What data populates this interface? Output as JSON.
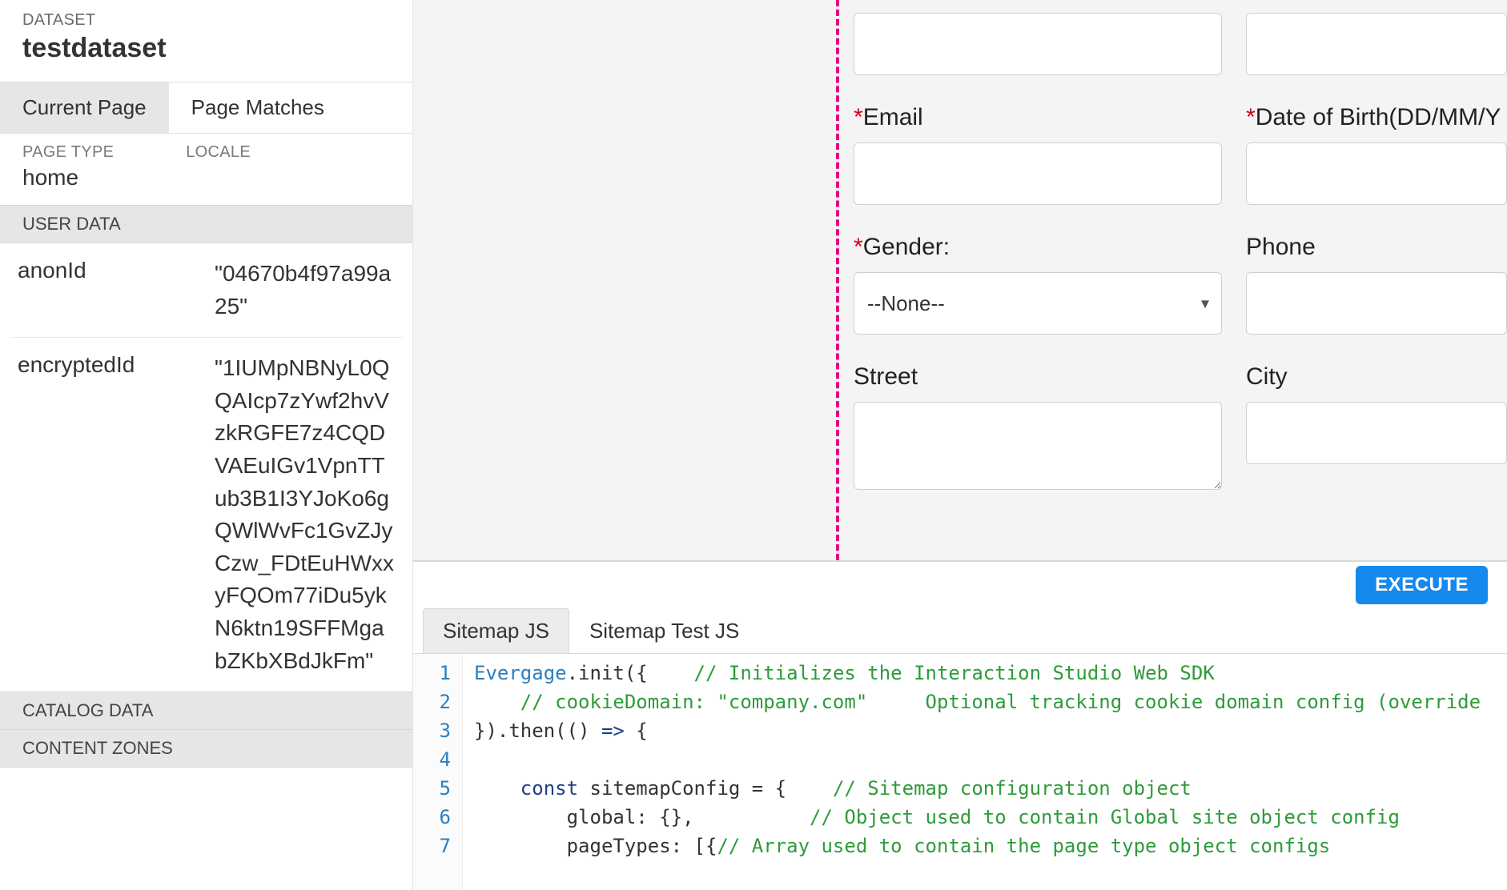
{
  "sidebar": {
    "dataset_label": "DATASET",
    "dataset_name": "testdataset",
    "tabs": {
      "current_page": "Current Page",
      "page_matches": "Page Matches"
    },
    "meta": {
      "page_type_label": "PAGE TYPE",
      "page_type_value": "home",
      "locale_label": "LOCALE",
      "locale_value": ""
    },
    "user_data_header": "USER DATA",
    "user_data": [
      {
        "key": "anonId",
        "value": "\"04670b4f97a99a25\""
      },
      {
        "key": "encryptedId",
        "value": "\"1IUMpNBNyL0QQAIcp7zYwf2hvVzkRGFE7z4CQDVAEuIGv1VpnTTub3B1I3YJoKo6gQWlWvFc1GvZJyCzw_FDtEuHWxxyFQOm77iDu5ykN6ktn19SFFMgabZKbXBdJkFm\""
      }
    ],
    "catalog_data_header": "CATALOG DATA",
    "content_zones_header": "CONTENT ZONES"
  },
  "form": {
    "fields": {
      "blank1_label": "",
      "blank2_label": "",
      "email_label": "Email",
      "dob_label": "Date of Birth(DD/MM/Y",
      "gender_label": "Gender:",
      "gender_value": "--None--",
      "phone_label": "Phone",
      "street_label": "Street",
      "city_label": "City"
    }
  },
  "exec": {
    "button_label": "EXECUTE"
  },
  "code": {
    "tabs": {
      "sitemap_js": "Sitemap JS",
      "sitemap_test_js": "Sitemap Test JS"
    },
    "lines": [
      {
        "n": "1",
        "seg": [
          {
            "c": "tk-id",
            "t": "Evergage"
          },
          {
            "c": "tk-punc",
            "t": ".init({    "
          },
          {
            "c": "tk-com",
            "t": "// Initializes the Interaction Studio Web SDK"
          }
        ]
      },
      {
        "n": "2",
        "seg": [
          {
            "c": "tk-punc",
            "t": "    "
          },
          {
            "c": "tk-com",
            "t": "// cookieDomain: \"company.com\"     Optional tracking cookie domain config (override"
          }
        ]
      },
      {
        "n": "3",
        "seg": [
          {
            "c": "tk-punc",
            "t": "}).then(() "
          },
          {
            "c": "tk-kw",
            "t": "=>"
          },
          {
            "c": "tk-punc",
            "t": " {"
          }
        ]
      },
      {
        "n": "4",
        "seg": [
          {
            "c": "tk-punc",
            "t": ""
          }
        ]
      },
      {
        "n": "5",
        "seg": [
          {
            "c": "tk-punc",
            "t": "    "
          },
          {
            "c": "tk-kw",
            "t": "const"
          },
          {
            "c": "tk-punc",
            "t": " sitemapConfig = {    "
          },
          {
            "c": "tk-com",
            "t": "// Sitemap configuration object"
          }
        ]
      },
      {
        "n": "6",
        "seg": [
          {
            "c": "tk-punc",
            "t": "        global: {},          "
          },
          {
            "c": "tk-com",
            "t": "// Object used to contain Global site object config"
          }
        ]
      },
      {
        "n": "7",
        "seg": [
          {
            "c": "tk-punc",
            "t": "        pageTypes: [{"
          },
          {
            "c": "tk-com",
            "t": "// Array used to contain the page type object configs"
          }
        ]
      }
    ]
  }
}
